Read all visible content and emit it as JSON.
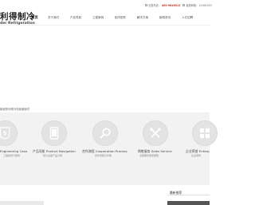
{
  "header": {
    "logo_cn": "利得制冷",
    "logo_en": "der Refrigeration",
    "phone_label": "全国热线：",
    "phone": "400-9846513",
    "email_label": "客服邮箱：12984365"
  },
  "nav": {
    "items": [
      "首页",
      "关于我们",
      "产品导航",
      "工程案例",
      "制冷配件",
      "解决方案",
      "新闻资讯",
      "人才招聘"
    ],
    "active_index": 0
  },
  "breadcrumb": "新颖的利得冷机依赖我们",
  "features": [
    {
      "title": "Engineering Case",
      "subtitle": "工程案例与服务",
      "icon": "html5-icon"
    },
    {
      "title": "产品导航 Product Navigation",
      "subtitle": "制冷设备产品分类",
      "icon": "tablet-icon"
    },
    {
      "title": "合作流程 Cooperation Process",
      "subtitle": "合作流程与步骤",
      "icon": "search-icon"
    },
    {
      "title": "销售服务 Sales Service",
      "subtitle": "全程服务质量保障",
      "icon": "tools-icon"
    },
    {
      "title": "企业荣誉 Enterp",
      "subtitle": "企业荣誉",
      "icon": "grid-icon"
    }
  ],
  "news": {
    "heading": "最新推荐"
  },
  "colors": {
    "accent": "#c0392b",
    "band": "#f2f2f2",
    "circle": "#e3e3e3"
  }
}
